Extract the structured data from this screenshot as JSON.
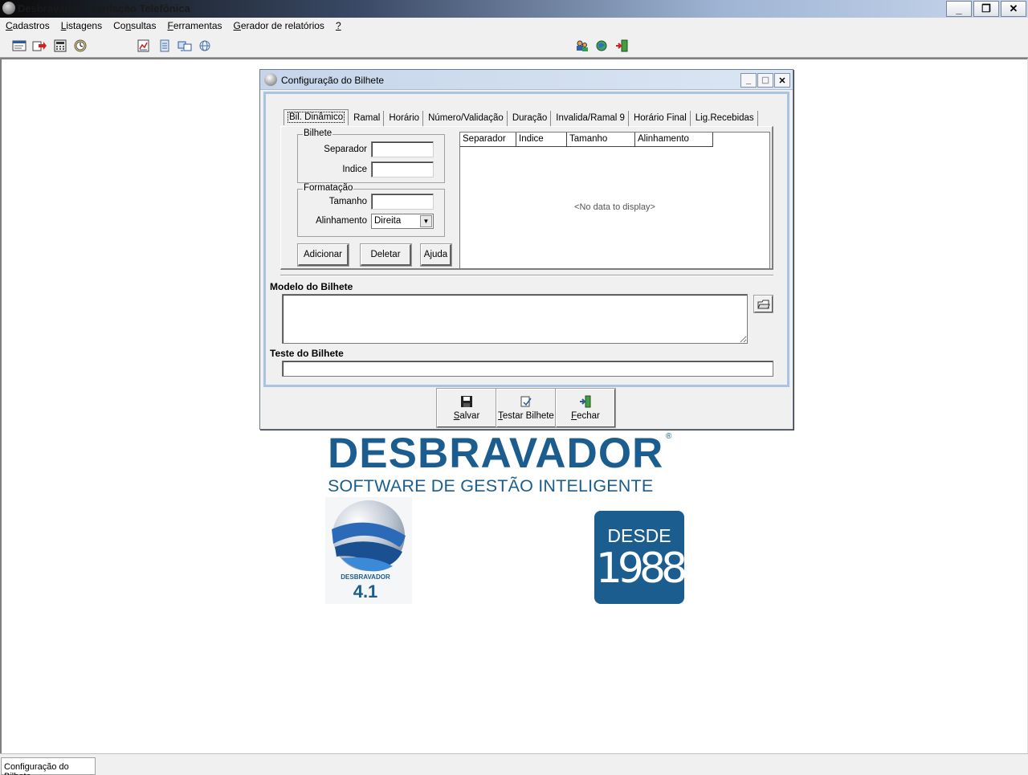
{
  "window": {
    "title": "Desbravador - Tarifação Telefônica",
    "buttons": [
      "minimize",
      "restore",
      "close"
    ]
  },
  "menu": {
    "items": [
      {
        "label": "Cadastros",
        "accel": "C"
      },
      {
        "label": "Listagens",
        "accel": "L"
      },
      {
        "label": "Consultas",
        "accel": "n"
      },
      {
        "label": "Ferramentas",
        "accel": "F"
      },
      {
        "label": "Gerador de relatórios",
        "accel": "G"
      },
      {
        "label": "?",
        "accel": "?"
      }
    ]
  },
  "toolbar": {
    "icons": [
      "form-icon",
      "arrow-icon",
      "calculator-icon",
      "clock-icon",
      "report-icon",
      "document-icon",
      "transfer-icon",
      "world-icon",
      "users-icon",
      "network-icon",
      "exit-icon"
    ]
  },
  "dialog": {
    "title": "Configuração do Bilhete",
    "tabs": [
      "Bil. Dinâmico",
      "Ramal",
      "Horário",
      "Número/Validação",
      "Duração",
      "Invalida/Ramal 9",
      "Horário Final",
      "Lig.Recebidas"
    ],
    "active_tab": "Bil. Dinâmico",
    "group_bilhete": {
      "legend": "Bilhete",
      "separador_label": "Separador",
      "separador_value": "",
      "indice_label": "Indice",
      "indice_value": ""
    },
    "group_formatacao": {
      "legend": "Formatação",
      "tamanho_label": "Tamanho",
      "tamanho_value": "",
      "alinhamento_label": "Alinhamento",
      "alinhamento_value": "Direita"
    },
    "buttons": {
      "adicionar": "Adicionar",
      "deletar": "Deletar",
      "ajuda": "Ajuda"
    },
    "grid": {
      "columns": [
        "Separador",
        "Indice",
        "Tamanho",
        "Alinhamento"
      ],
      "empty_text": "<No data to display>"
    },
    "modelo_label": "Modelo do Bilhete",
    "modelo_value": "",
    "teste_label": "Teste do Bilhete",
    "teste_value": "",
    "footer": {
      "salvar": {
        "label": "Salvar",
        "accel": "S"
      },
      "testar": {
        "label": "Testar Bilhete",
        "accel": "T"
      },
      "fechar": {
        "label": "Fechar",
        "accel": "F"
      }
    }
  },
  "branding": {
    "name": "DESBRAVADOR",
    "reg": "®",
    "tagline": "SOFTWARE DE GESTÃO INTELIGENTE",
    "product_label": "DESBRAVADOR",
    "product_version": "4.1",
    "since_word": "DESDE",
    "since_year": "1988",
    "color": "#1a5d8e"
  },
  "statusbar": {
    "panel_text": "Configuração do Bilhete"
  }
}
